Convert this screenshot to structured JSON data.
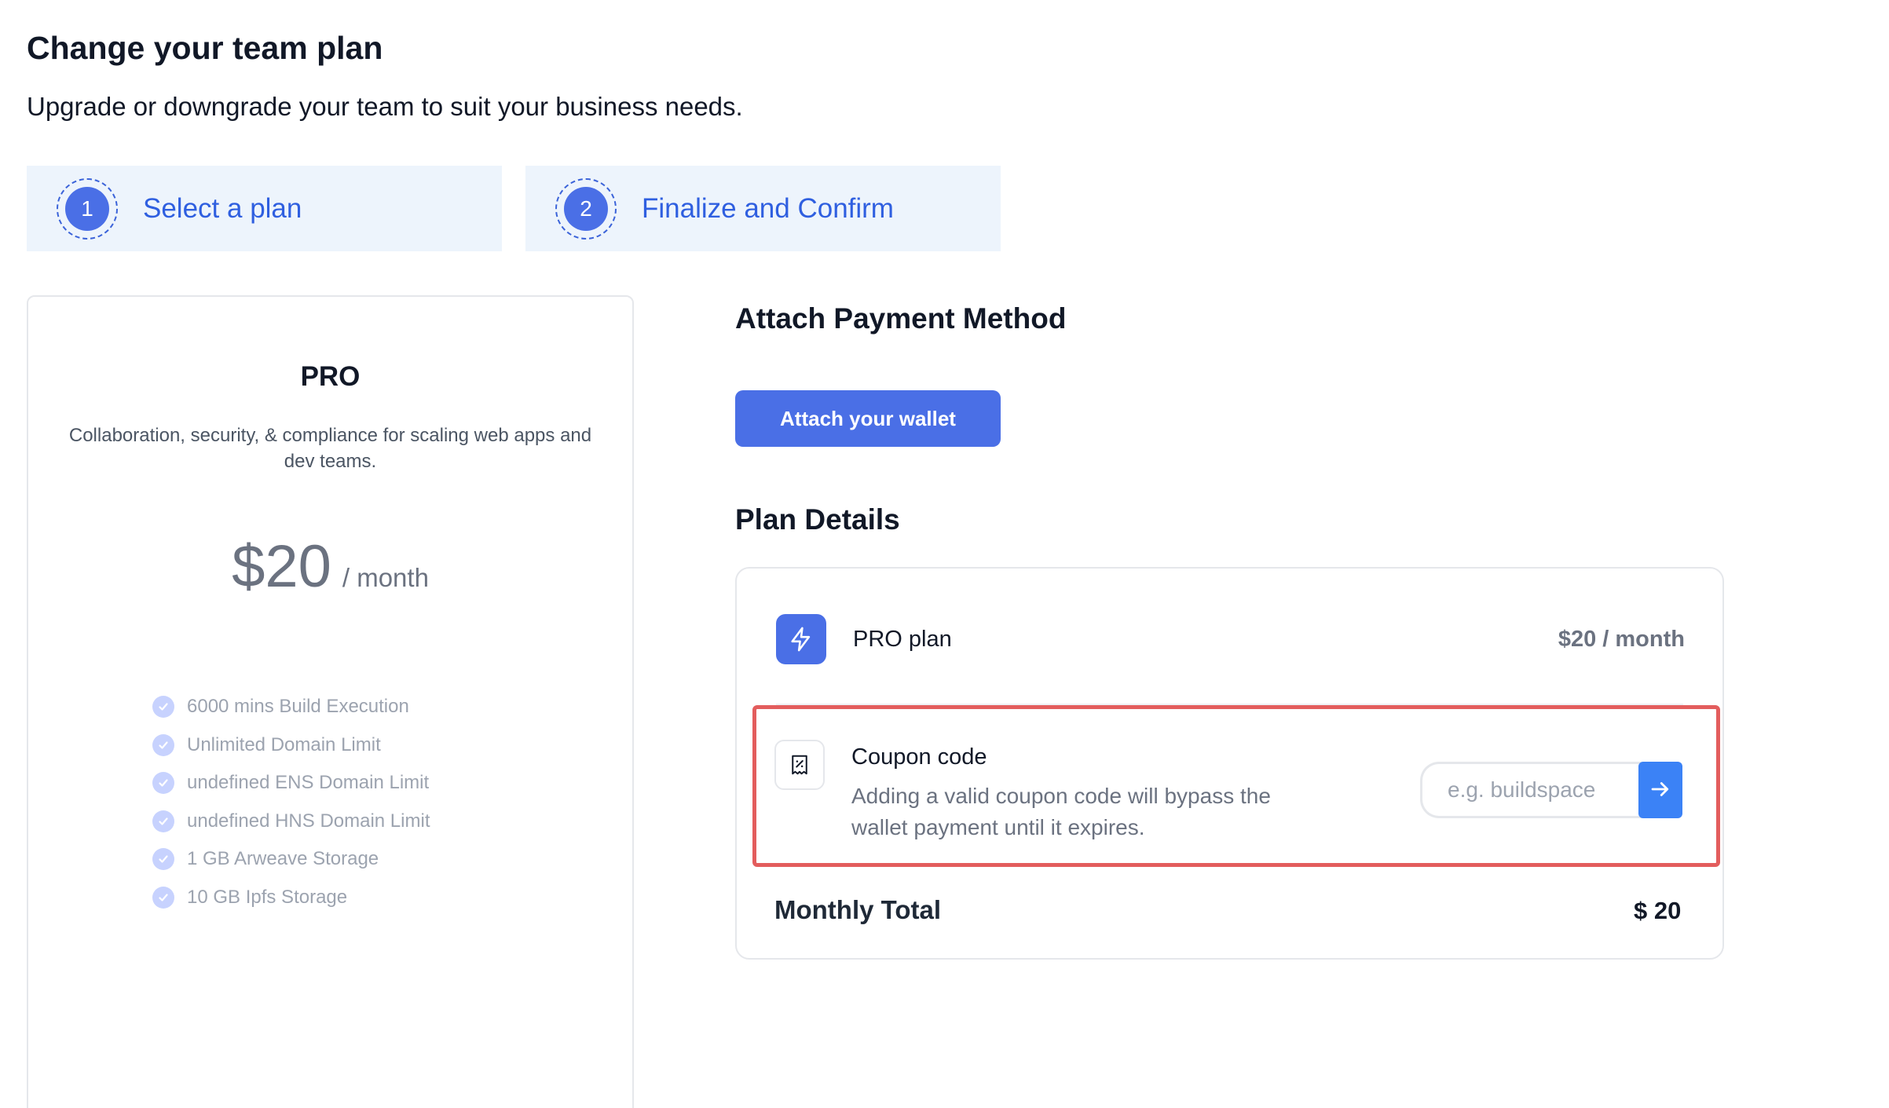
{
  "header": {
    "title": "Change your team plan",
    "subtitle": "Upgrade or downgrade your team to suit your business needs."
  },
  "steps": [
    {
      "number": "1",
      "label": "Select a plan"
    },
    {
      "number": "2",
      "label": "Finalize and Confirm"
    }
  ],
  "plan_card": {
    "name": "PRO",
    "description": "Collaboration, security, & compliance for scaling web apps and dev teams.",
    "price": "$20",
    "period": "/ month",
    "features": [
      "6000 mins Build Execution",
      "Unlimited Domain Limit",
      "undefined ENS Domain Limit",
      "undefined HNS Domain Limit",
      "1 GB Arweave Storage",
      "10 GB Ipfs Storage"
    ]
  },
  "payment": {
    "title": "Attach Payment Method",
    "attach_label": "Attach your wallet"
  },
  "plan_details": {
    "title": "Plan Details",
    "plan_label": "PRO plan",
    "plan_price": "$20 / month",
    "coupon_title": "Coupon code",
    "coupon_desc": "Adding a valid coupon code will bypass the wallet payment until it expires.",
    "coupon_placeholder": "e.g. buildspace",
    "coupon_value": "",
    "total_label": "Monthly Total",
    "total_value": "$ 20"
  },
  "icons": {
    "step_indicator": "numbered-circle-icon",
    "feature_check": "check-circle-icon",
    "pro_plan": "lightning-bolt-icon",
    "coupon": "ticket-icon",
    "submit": "arrow-right-icon"
  },
  "colors": {
    "accent": "#4a6fe6",
    "step_bg": "#edf4fc",
    "highlight_border": "#e35d5d",
    "submit_button": "#3b82f6"
  }
}
